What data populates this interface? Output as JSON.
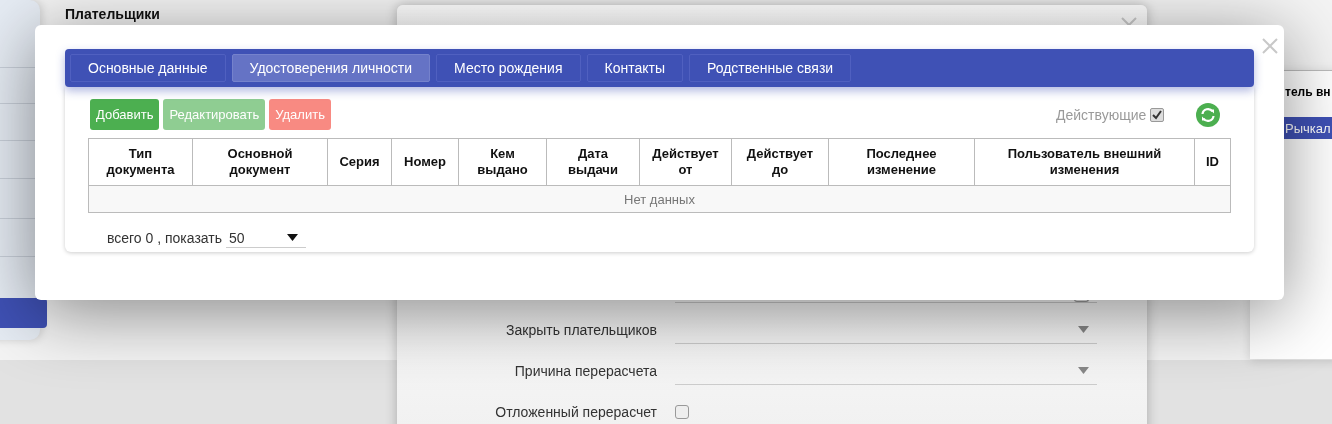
{
  "page_title": "Плательщики",
  "back_dialog": {
    "rows": [
      {
        "kind": "box-field"
      },
      {
        "kind": "select",
        "label": "Закрыть плательщиков"
      },
      {
        "kind": "select",
        "label": "Причина перерасчета"
      },
      {
        "kind": "checkbox",
        "label": "Отложенный перерасчет",
        "checked": false
      }
    ]
  },
  "right_panel": {
    "heading": "тель вн",
    "button": "Рычкал"
  },
  "modal": {
    "tabs": [
      {
        "label": "Основные данные",
        "selected": false
      },
      {
        "label": "Удостоверения личности",
        "selected": true
      },
      {
        "label": "Место рождения",
        "selected": false
      },
      {
        "label": "Контакты",
        "selected": false
      },
      {
        "label": "Родственные связи",
        "selected": false
      }
    ],
    "buttons": [
      {
        "label": "Добавить",
        "kind": "add",
        "disabled": false
      },
      {
        "label": "Редактировать",
        "kind": "edit",
        "disabled": true
      },
      {
        "label": "Удалить",
        "kind": "delete",
        "disabled": true
      }
    ],
    "active_filter": {
      "label": "Действующие",
      "checked": true
    },
    "table": {
      "columns": [
        "Тип документа",
        "Основной документ",
        "Серия",
        "Номер",
        "Кем выдано",
        "Дата выдачи",
        "Действует от",
        "Действует до",
        "Последнее изменение",
        "Пользователь внешний изменения",
        "ID"
      ],
      "empty_text": "Нет данных"
    },
    "footer": {
      "summary": "всего 0 , показать",
      "page_size": "50"
    }
  }
}
